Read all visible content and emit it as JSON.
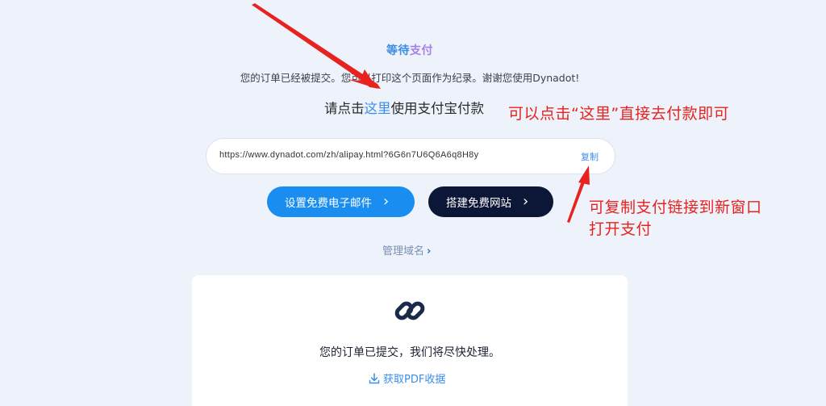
{
  "status": {
    "title_part1": "等待",
    "title_part2": "支付",
    "subtitle": "您的订单已经被提交。您可以打印这个页面作为纪录。谢谢您使用Dynadot!"
  },
  "payment": {
    "prefix": "请点击",
    "link_label": "这里",
    "suffix": "使用支付宝付款",
    "url": "https://www.dynadot.com/zh/alipay.html?6G6n7U6Q6A6q8H8y",
    "copy_label": "复制"
  },
  "actions": {
    "email_button": "设置免费电子邮件",
    "site_button": "搭建免费网站",
    "chevron": "›"
  },
  "manage": {
    "label": "管理域名",
    "chevron": "›"
  },
  "card": {
    "icon": "link-icon",
    "message": "您的订单已提交，我们将尽快处理。",
    "pdf_label": "获取PDF收据"
  },
  "annotations": {
    "note1": "可以点击“这里”直接去付款即可",
    "note2_line1": "可复制支付链接到新窗口",
    "note2_line2": "打开支付"
  },
  "colors": {
    "background": "#edf2fb",
    "accent_blue": "#1a8ef0",
    "dark_navy": "#0c1737",
    "link_blue": "#3b8de8",
    "annotation_red": "#e8231f"
  }
}
